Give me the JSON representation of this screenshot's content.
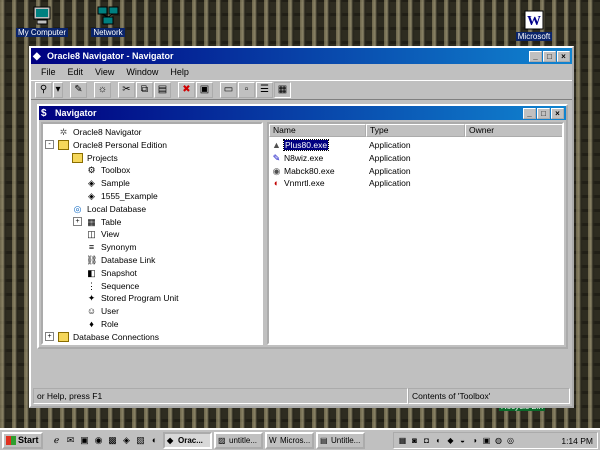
{
  "desktop": {
    "icons": [
      {
        "label": "My Computer",
        "icon": "computer-icon"
      },
      {
        "label": "Network",
        "icon": "network-icon"
      },
      {
        "label": "Microsoft",
        "icon": "word-icon"
      },
      {
        "label": "Recycle Bin",
        "icon": "recycle-bin-icon"
      }
    ]
  },
  "app_window": {
    "title": "Oracle8 Navigator - Navigator",
    "menu": [
      "File",
      "Edit",
      "View",
      "Window",
      "Help"
    ],
    "toolbar_icons": [
      "connect-icon",
      "dropdown-icon",
      "new-icon",
      "properties-icon",
      "cut-icon",
      "copy-icon",
      "paste-icon",
      "delete-icon",
      "stop-icon",
      "large-icons-icon",
      "small-icons-icon",
      "list-view-icon",
      "details-view-icon"
    ]
  },
  "navigator": {
    "title": "Navigator",
    "tree": [
      {
        "label": "Oracle8 Navigator",
        "level": 0,
        "expander": "",
        "icon": "navigator-icon"
      },
      {
        "label": "Oracle8 Personal Edition",
        "level": 0,
        "expander": "-",
        "icon": "folder-icon"
      },
      {
        "label": "Projects",
        "level": 1,
        "expander": "",
        "icon": "folder-icon"
      },
      {
        "label": "Toolbox",
        "level": 2,
        "expander": "",
        "icon": "toolbox-icon"
      },
      {
        "label": "Sample",
        "level": 2,
        "expander": "",
        "icon": "project-icon"
      },
      {
        "label": "1555_Example",
        "level": 2,
        "expander": "",
        "icon": "project-icon"
      },
      {
        "label": "Local Database",
        "level": 1,
        "expander": "",
        "icon": "database-icon"
      },
      {
        "label": "Table",
        "level": 2,
        "expander": "+",
        "icon": "table-icon"
      },
      {
        "label": "View",
        "level": 2,
        "expander": "",
        "icon": "view-icon"
      },
      {
        "label": "Synonym",
        "level": 2,
        "expander": "",
        "icon": "synonym-icon"
      },
      {
        "label": "Database Link",
        "level": 2,
        "expander": "",
        "icon": "link-icon"
      },
      {
        "label": "Snapshot",
        "level": 2,
        "expander": "",
        "icon": "snapshot-icon"
      },
      {
        "label": "Sequence",
        "level": 2,
        "expander": "",
        "icon": "sequence-icon"
      },
      {
        "label": "Stored Program Unit",
        "level": 2,
        "expander": "",
        "icon": "program-icon"
      },
      {
        "label": "User",
        "level": 2,
        "expander": "",
        "icon": "user-icon"
      },
      {
        "label": "Role",
        "level": 2,
        "expander": "",
        "icon": "role-icon"
      },
      {
        "label": "Database Connections",
        "level": 0,
        "expander": "+",
        "icon": "folder-icon"
      }
    ],
    "columns": [
      "Name",
      "Type",
      "Owner"
    ],
    "rows": [
      {
        "name": "Plus80.exe",
        "type": "Application",
        "owner": "",
        "icon": "sqlplus-icon",
        "selected": true
      },
      {
        "name": "N8wiz.exe",
        "type": "Application",
        "owner": "",
        "icon": "wizard-icon",
        "selected": false
      },
      {
        "name": "Mabck80.exe",
        "type": "Application",
        "owner": "",
        "icon": "backup-icon",
        "selected": false
      },
      {
        "name": "Vnmrtl.exe",
        "type": "Application",
        "owner": "",
        "icon": "app-icon",
        "selected": false
      }
    ]
  },
  "status": {
    "left": "or Help, press F1",
    "right": "Contents of 'Toolbox'"
  },
  "taskbar": {
    "start_label": "Start",
    "quick_launch": [
      "ie-icon",
      "outlook-icon",
      "desktop-icon",
      "channels-icon",
      "app-icon-1",
      "app-icon-2",
      "app-icon-3",
      "app-icon-4"
    ],
    "tasks": [
      {
        "label": "Orac...",
        "active": true
      },
      {
        "label": "untitle...",
        "active": false
      },
      {
        "label": "Micros...",
        "active": false
      },
      {
        "label": "Untitle...",
        "active": false
      }
    ],
    "tray_icons": [
      "tray-icon-1",
      "tray-icon-2",
      "tray-icon-3",
      "tray-icon-4",
      "tray-icon-5",
      "tray-icon-6",
      "tray-icon-7",
      "tray-icon-8",
      "tray-icon-9",
      "tray-icon-10"
    ],
    "clock": "1:14 PM"
  },
  "colors": {
    "titlebar_active": "#000080",
    "face": "#c0c0c0",
    "selection": "#000080"
  }
}
